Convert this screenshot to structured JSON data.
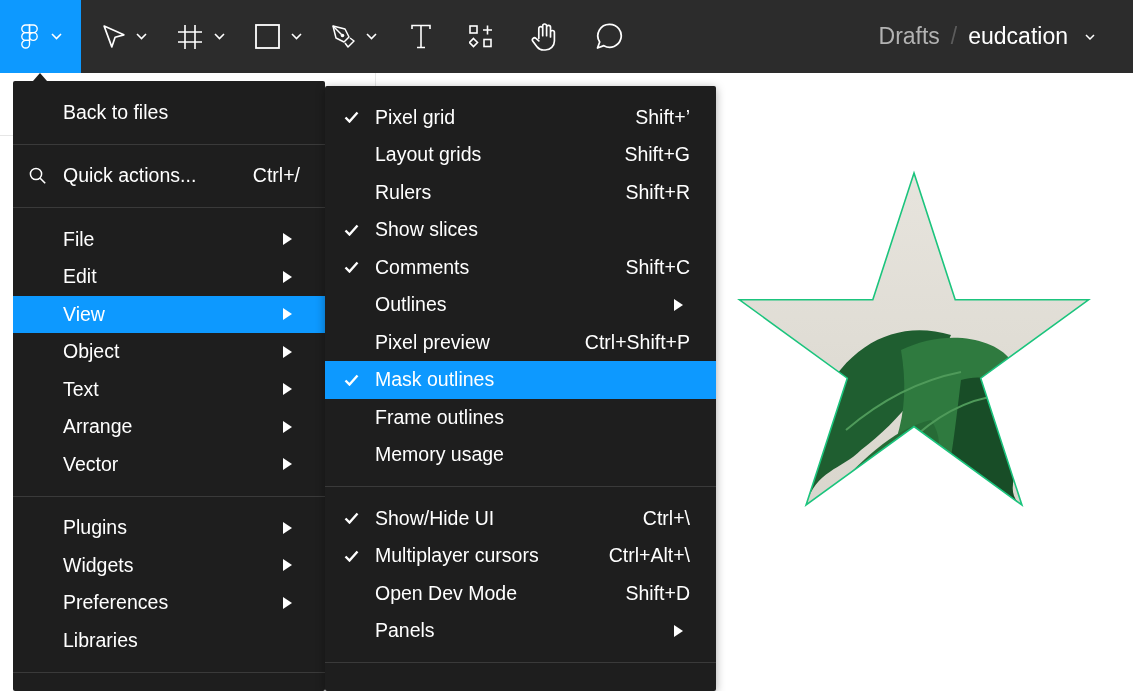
{
  "toolbar": {
    "main_menu_button": {
      "open": true
    },
    "tools": [
      {
        "kind": "move",
        "dropdown": true,
        "selected": false
      },
      {
        "kind": "frame",
        "dropdown": true,
        "selected": false
      },
      {
        "kind": "shape",
        "dropdown": true,
        "selected": false
      },
      {
        "kind": "pen",
        "dropdown": true,
        "selected": false
      },
      {
        "kind": "text",
        "dropdown": false,
        "selected": false
      },
      {
        "kind": "resources",
        "dropdown": false,
        "selected": false
      },
      {
        "kind": "hand",
        "dropdown": false,
        "selected": false
      },
      {
        "kind": "comment",
        "dropdown": false,
        "selected": false
      }
    ],
    "breadcrumb": {
      "folder": "Drafts",
      "separator": "/",
      "file": "eudcation"
    }
  },
  "main_menu": {
    "sections": [
      {
        "items": [
          {
            "kind": "command",
            "label": "Back to files",
            "submenu": false,
            "selected": false
          }
        ]
      },
      {
        "items": [
          {
            "kind": "search",
            "label": "Quick actions...",
            "shortcut": "Ctrl+/",
            "submenu": false,
            "selected": false
          }
        ]
      },
      {
        "items": [
          {
            "kind": "command",
            "label": "File",
            "submenu": true,
            "selected": false
          },
          {
            "kind": "command",
            "label": "Edit",
            "submenu": true,
            "selected": false
          },
          {
            "kind": "command",
            "label": "View",
            "submenu": true,
            "selected": true
          },
          {
            "kind": "command",
            "label": "Object",
            "submenu": true,
            "selected": false
          },
          {
            "kind": "command",
            "label": "Text",
            "submenu": true,
            "selected": false
          },
          {
            "kind": "command",
            "label": "Arrange",
            "submenu": true,
            "selected": false
          },
          {
            "kind": "command",
            "label": "Vector",
            "submenu": true,
            "selected": false
          }
        ]
      },
      {
        "items": [
          {
            "kind": "command",
            "label": "Plugins",
            "submenu": true,
            "selected": false
          },
          {
            "kind": "command",
            "label": "Widgets",
            "submenu": true,
            "selected": false
          },
          {
            "kind": "command",
            "label": "Preferences",
            "submenu": true,
            "selected": false
          },
          {
            "kind": "command",
            "label": "Libraries",
            "submenu": false,
            "selected": false
          }
        ]
      }
    ]
  },
  "view_submenu": {
    "sections": [
      {
        "items": [
          {
            "label": "Pixel grid",
            "shortcut": "Shift+’",
            "checked": true,
            "submenu": false,
            "selected": false
          },
          {
            "label": "Layout grids",
            "shortcut": "Shift+G",
            "checked": false,
            "submenu": false,
            "selected": false
          },
          {
            "label": "Rulers",
            "shortcut": "Shift+R",
            "checked": false,
            "submenu": false,
            "selected": false
          },
          {
            "label": "Show slices",
            "checked": true,
            "submenu": false,
            "selected": false
          },
          {
            "label": "Comments",
            "shortcut": "Shift+C",
            "checked": true,
            "submenu": false,
            "selected": false
          },
          {
            "label": "Outlines",
            "checked": false,
            "submenu": true,
            "selected": false
          },
          {
            "label": "Pixel preview",
            "shortcut": "Ctrl+Shift+P",
            "checked": false,
            "submenu": false,
            "selected": false
          },
          {
            "label": "Mask outlines",
            "checked": true,
            "submenu": false,
            "selected": true
          },
          {
            "label": "Frame outlines",
            "checked": false,
            "submenu": false,
            "selected": false
          },
          {
            "label": "Memory usage",
            "checked": false,
            "submenu": false,
            "selected": false
          }
        ]
      },
      {
        "items": [
          {
            "label": "Show/Hide UI",
            "shortcut": "Ctrl+\\",
            "checked": true,
            "submenu": false,
            "selected": false
          },
          {
            "label": "Multiplayer cursors",
            "shortcut": "Ctrl+Alt+\\",
            "checked": true,
            "submenu": false,
            "selected": false
          },
          {
            "label": "Open Dev Mode",
            "shortcut": "Shift+D",
            "checked": false,
            "submenu": false,
            "selected": false
          },
          {
            "label": "Panels",
            "checked": false,
            "submenu": true,
            "selected": false
          }
        ]
      }
    ]
  }
}
